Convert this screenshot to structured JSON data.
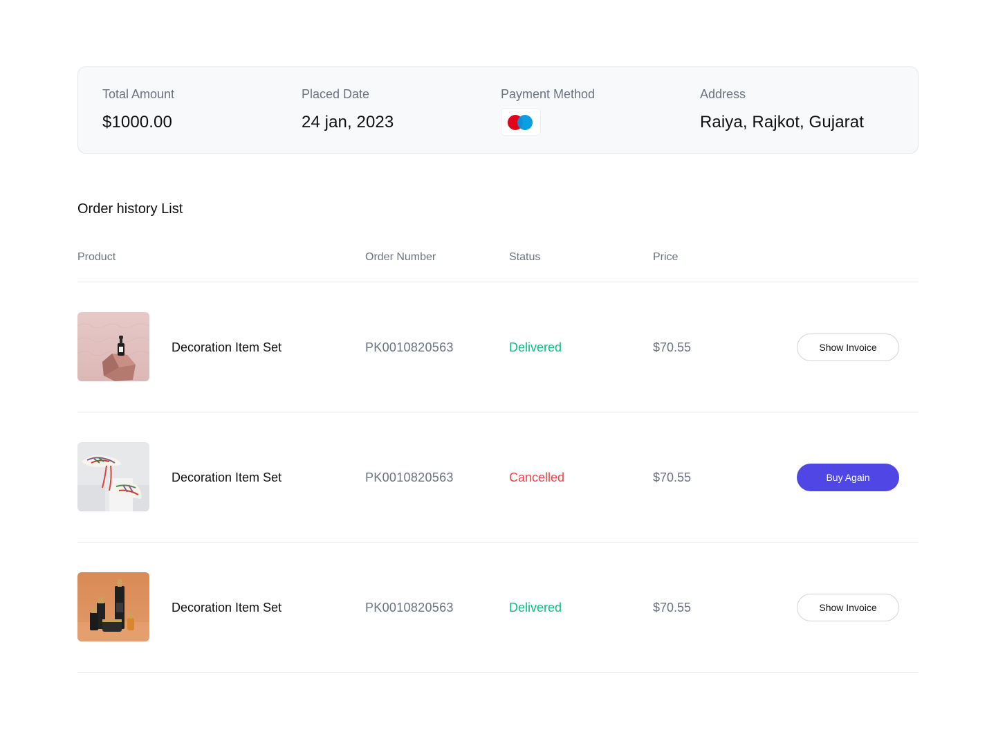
{
  "summary": {
    "total_amount": {
      "label": "Total Amount",
      "value": "$1000.00"
    },
    "placed_date": {
      "label": "Placed Date",
      "value": "24 jan, 2023"
    },
    "payment_method": {
      "label": "Payment Method",
      "icon": "maestro-card-icon"
    },
    "address": {
      "label": "Address",
      "value": "Raiya, Rajkot, Gujarat"
    }
  },
  "order_history": {
    "title": "Order history List",
    "columns": [
      "Product",
      "Order Number",
      "Status",
      "Price"
    ],
    "rows": [
      {
        "product": "Decoration Item Set",
        "image": "dropper-bottle-on-pedestal",
        "order_number": "PK0010820563",
        "status": "Delivered",
        "price": "$70.55",
        "action": "Show Invoice"
      },
      {
        "product": "Decoration Item Set",
        "image": "sneakers-on-white-block",
        "order_number": "PK0010820563",
        "status": "Cancelled",
        "price": "$70.55",
        "action": "Buy Again"
      },
      {
        "product": "Decoration Item Set",
        "image": "cosmetic-bottles-orange",
        "order_number": "PK0010820563",
        "status": "Delivered",
        "price": "$70.55",
        "action": "Show Invoice"
      }
    ]
  },
  "colors": {
    "delivered": "#10b981",
    "cancelled": "#ef4444",
    "primary_button": "#4f46e5",
    "maestro_red": "#e3001b",
    "maestro_blue": "#0099df"
  }
}
